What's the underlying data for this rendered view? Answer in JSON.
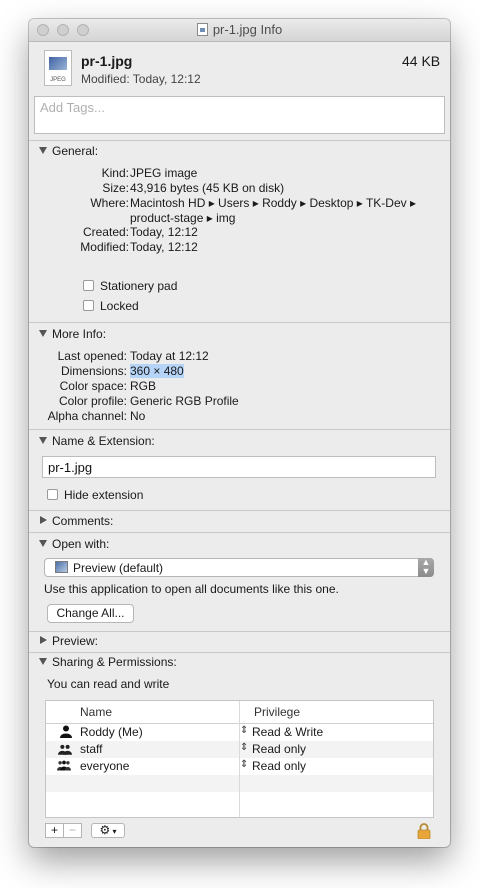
{
  "window": {
    "title": "pr-1.jpg Info"
  },
  "header": {
    "file_name": "pr-1.jpg",
    "file_size": "44 KB",
    "modified": "Modified: Today, 12:12",
    "icon_label": "JPEG"
  },
  "tags": {
    "placeholder": "Add Tags..."
  },
  "general": {
    "title": "General:",
    "kind_label": "Kind:",
    "kind": "JPEG image",
    "size_label": "Size:",
    "size": "43,916 bytes (45 KB on disk)",
    "where_label": "Where:",
    "where_line1": "Macintosh HD ▸ Users ▸ Roddy ▸ Desktop ▸ TK-Dev ▸",
    "where_line2": "product-stage ▸ img",
    "created_label": "Created:",
    "created": "Today, 12:12",
    "modified_label": "Modified:",
    "modified": "Today, 12:12",
    "stationery": "Stationery pad",
    "locked": "Locked"
  },
  "more_info": {
    "title": "More Info:",
    "last_opened_label": "Last opened:",
    "last_opened": "Today at 12:12",
    "dimensions_label": "Dimensions:",
    "dimensions": "360 × 480",
    "color_space_label": "Color space:",
    "color_space": "RGB",
    "color_profile_label": "Color profile:",
    "color_profile": "Generic RGB Profile",
    "alpha_label": "Alpha channel:",
    "alpha": "No"
  },
  "name_ext": {
    "title": "Name & Extension:",
    "value": "pr-1.jpg",
    "hide_extension": "Hide extension"
  },
  "comments": {
    "title": "Comments:"
  },
  "open_with": {
    "title": "Open with:",
    "app": "Preview (default)",
    "note": "Use this application to open all documents like this one.",
    "change_all": "Change All..."
  },
  "preview": {
    "title": "Preview:"
  },
  "sharing": {
    "title": "Sharing & Permissions:",
    "status": "You can read and write",
    "col_name": "Name",
    "col_privilege": "Privilege",
    "rows": [
      {
        "name": "Roddy (Me)",
        "privilege": "Read & Write"
      },
      {
        "name": "staff",
        "privilege": "Read only"
      },
      {
        "name": "everyone",
        "privilege": "Read only"
      }
    ],
    "add": "+",
    "remove": "−",
    "action": "⚙"
  }
}
